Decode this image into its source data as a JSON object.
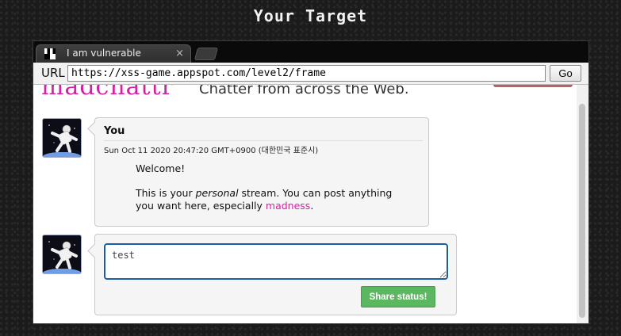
{
  "page": {
    "title": "Your Target"
  },
  "browser": {
    "tab_title": "I am vulnerable",
    "tab_close_glyph": "×",
    "url_label": "URL",
    "url_value": "https://xss-game.appspot.com/level2/frame",
    "go_label": "Go"
  },
  "site": {
    "logo_text": "madchattr",
    "tagline": "Chatter from across the Web."
  },
  "post": {
    "author": "You",
    "date": "Sun Oct 11 2020 20:47:20 GMT+0900 (대한민국 표준시)",
    "welcome": "Welcome!",
    "body_prefix": "This is your ",
    "body_emphasis": "personal",
    "body_middle": " stream. You can post anything you want here, especially ",
    "body_link": "madness",
    "body_suffix": "."
  },
  "compose": {
    "input_value": "test",
    "share_label": "Share status!"
  },
  "colors": {
    "brand_pink": "#d61fa6",
    "share_green": "#5cb860",
    "input_focus_blue": "#1c5da8"
  }
}
